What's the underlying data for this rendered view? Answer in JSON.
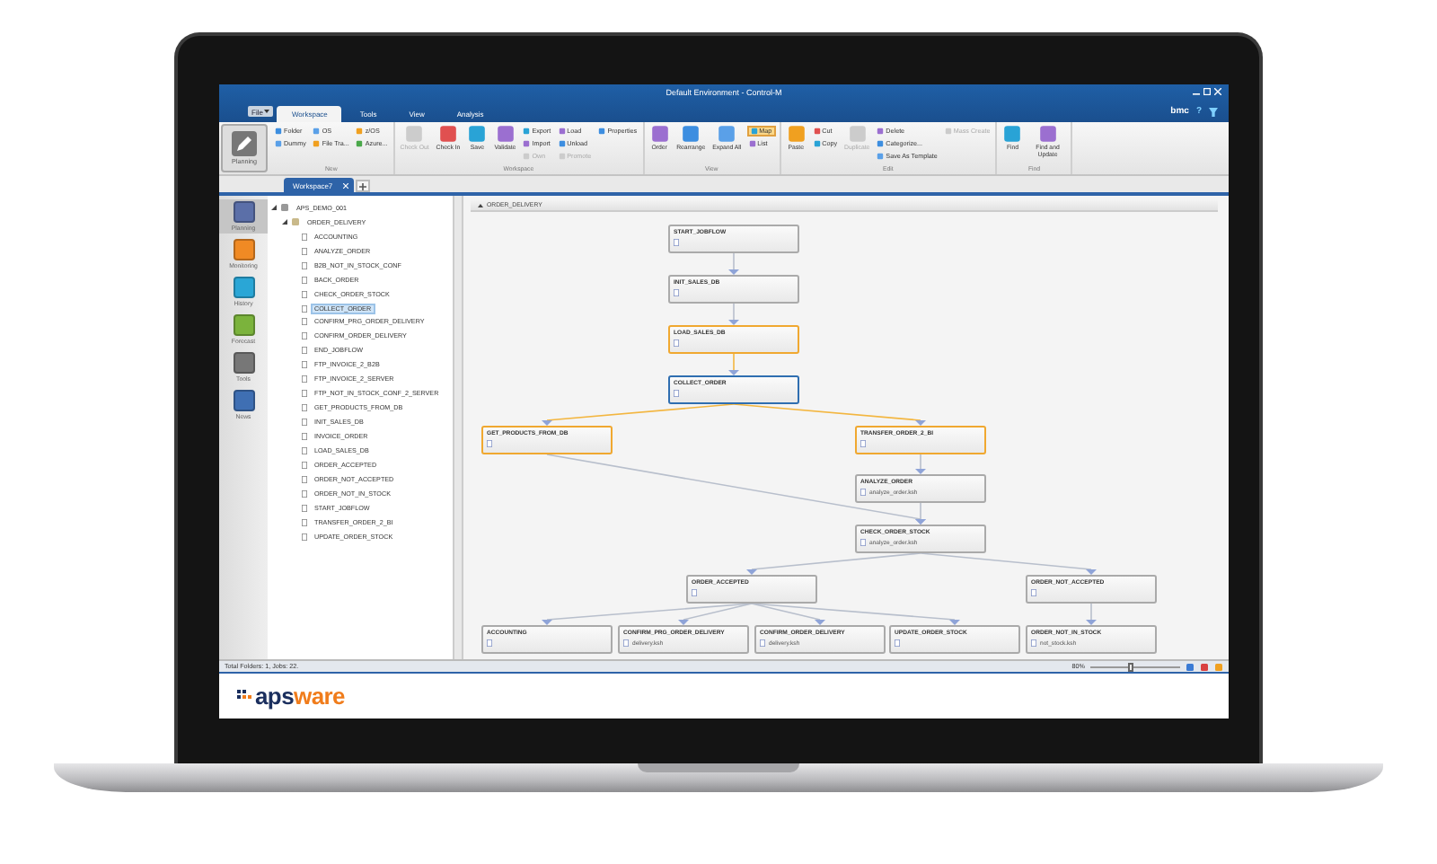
{
  "window": {
    "title": "Default Environment - Control-M"
  },
  "menu": {
    "file": "File",
    "tabs": [
      {
        "label": "Workspace",
        "selected": true
      },
      {
        "label": "Tools",
        "selected": false
      },
      {
        "label": "View",
        "selected": false
      },
      {
        "label": "Analysis",
        "selected": false
      }
    ],
    "brand": "bmc",
    "help": "?"
  },
  "ribbon": {
    "planning": {
      "label": "Planning"
    },
    "groups": [
      {
        "label": "New",
        "columns": [
          {
            "kind": "stack",
            "items": [
              {
                "label": "Folder",
                "disabled": false,
                "selected": false
              },
              {
                "label": "Dummy",
                "disabled": false,
                "selected": false
              }
            ]
          },
          {
            "kind": "stack",
            "items": [
              {
                "label": "OS",
                "disabled": false,
                "selected": false
              },
              {
                "label": "File Tra...",
                "disabled": false,
                "selected": false
              }
            ]
          },
          {
            "kind": "stack",
            "items": [
              {
                "label": "z/OS",
                "disabled": false,
                "selected": false
              },
              {
                "label": "Azure...",
                "disabled": false,
                "selected": false
              }
            ]
          }
        ]
      },
      {
        "label": "Workspace",
        "columns": [
          {
            "kind": "large",
            "label": "Check Out",
            "disabled": true
          },
          {
            "kind": "large",
            "label": "Check In",
            "disabled": false
          },
          {
            "kind": "large",
            "label": "Save",
            "disabled": false
          },
          {
            "kind": "large",
            "label": "Validate",
            "disabled": false
          },
          {
            "kind": "stack",
            "items": [
              {
                "label": "Export",
                "disabled": false,
                "selected": false
              },
              {
                "label": "Import",
                "disabled": false,
                "selected": false
              },
              {
                "label": "Own",
                "disabled": true,
                "selected": false
              }
            ]
          },
          {
            "kind": "stack",
            "items": [
              {
                "label": "Load",
                "disabled": false,
                "selected": false
              },
              {
                "label": "Unload",
                "disabled": false,
                "selected": false
              },
              {
                "label": "Promote",
                "disabled": true,
                "selected": false
              }
            ]
          },
          {
            "kind": "stack",
            "items": [
              {
                "label": "Properties",
                "disabled": false,
                "selected": false
              }
            ]
          }
        ]
      },
      {
        "label": "View",
        "columns": [
          {
            "kind": "large",
            "label": "Order",
            "disabled": false
          },
          {
            "kind": "large",
            "label": "Rearrange",
            "disabled": false
          },
          {
            "kind": "large",
            "label": "Expand All",
            "disabled": false
          },
          {
            "kind": "stack",
            "items": [
              {
                "label": "Map",
                "disabled": false,
                "selected": true
              },
              {
                "label": "List",
                "disabled": false,
                "selected": false
              }
            ]
          }
        ]
      },
      {
        "label": "Edit",
        "columns": [
          {
            "kind": "large",
            "label": "Paste",
            "disabled": false
          },
          {
            "kind": "stack",
            "items": [
              {
                "label": "Cut",
                "disabled": false,
                "selected": false
              },
              {
                "label": "Copy",
                "disabled": false,
                "selected": false
              }
            ]
          },
          {
            "kind": "large",
            "label": "Duplicate",
            "disabled": true
          },
          {
            "kind": "stack",
            "items": [
              {
                "label": "Delete",
                "disabled": false,
                "selected": false
              },
              {
                "label": "Categorize...",
                "disabled": false,
                "selected": false
              },
              {
                "label": "Save As Template",
                "disabled": false,
                "selected": false
              }
            ]
          },
          {
            "kind": "stack",
            "items": [
              {
                "label": "Mass Create",
                "disabled": true,
                "selected": false
              }
            ]
          }
        ]
      },
      {
        "label": "Find",
        "columns": [
          {
            "kind": "large",
            "label": "Find",
            "disabled": false
          },
          {
            "kind": "large",
            "label": "Find and Update",
            "disabled": false
          }
        ]
      }
    ]
  },
  "doc_tabs": [
    {
      "label": "Workspace7",
      "selected": true
    }
  ],
  "nav": [
    {
      "label": "Planning",
      "selected": true
    },
    {
      "label": "Monitoring",
      "selected": false
    },
    {
      "label": "History",
      "selected": false
    },
    {
      "label": "Forecast",
      "selected": false
    },
    {
      "label": "Tools",
      "selected": false
    },
    {
      "label": "News",
      "selected": false
    }
  ],
  "tree": {
    "label": "APS_DEMO_001",
    "expanded": true,
    "children": [
      {
        "label": "ORDER_DELIVERY",
        "expanded": true,
        "children": [
          {
            "label": "ACCOUNTING",
            "selected": false
          },
          {
            "label": "ANALYZE_ORDER",
            "selected": false
          },
          {
            "label": "B2B_NOT_IN_STOCK_CONF",
            "selected": false
          },
          {
            "label": "BACK_ORDER",
            "selected": false
          },
          {
            "label": "CHECK_ORDER_STOCK",
            "selected": false
          },
          {
            "label": "COLLECT_ORDER",
            "selected": true
          },
          {
            "label": "CONFIRM_PRG_ORDER_DELIVERY",
            "selected": false
          },
          {
            "label": "CONFIRM_ORDER_DELIVERY",
            "selected": false
          },
          {
            "label": "END_JOBFLOW",
            "selected": false
          },
          {
            "label": "FTP_INVOICE_2_B2B",
            "selected": false
          },
          {
            "label": "FTP_INVOICE_2_SERVER",
            "selected": false
          },
          {
            "label": "FTP_NOT_IN_STOCK_CONF_2_SERVER",
            "selected": false
          },
          {
            "label": "GET_PRODUCTS_FROM_DB",
            "selected": false
          },
          {
            "label": "INIT_SALES_DB",
            "selected": false
          },
          {
            "label": "INVOICE_ORDER",
            "selected": false
          },
          {
            "label": "LOAD_SALES_DB",
            "selected": false
          },
          {
            "label": "ORDER_ACCEPTED",
            "selected": false
          },
          {
            "label": "ORDER_NOT_ACCEPTED",
            "selected": false
          },
          {
            "label": "ORDER_NOT_IN_STOCK",
            "selected": false
          },
          {
            "label": "START_JOBFLOW",
            "selected": false
          },
          {
            "label": "TRANSFER_ORDER_2_BI",
            "selected": false
          },
          {
            "label": "UPDATE_ORDER_STOCK",
            "selected": false
          }
        ]
      }
    ]
  },
  "canvas": {
    "folder": "ORDER_DELIVERY",
    "nodes": [
      {
        "name": "START_JOBFLOW",
        "highlighted": false,
        "selected": false
      },
      {
        "name": "INIT_SALES_DB",
        "highlighted": false,
        "selected": false
      },
      {
        "name": "LOAD_SALES_DB",
        "highlighted": true,
        "selected": false
      },
      {
        "name": "COLLECT_ORDER",
        "highlighted": false,
        "selected": true
      },
      {
        "name": "GET_PRODUCTS_FROM_DB",
        "highlighted": true,
        "selected": false
      },
      {
        "name": "TRANSFER_ORDER_2_BI",
        "highlighted": true,
        "selected": false
      },
      {
        "name": "ANALYZE_ORDER",
        "script": "analyze_order.ksh",
        "highlighted": false,
        "selected": false
      },
      {
        "name": "CHECK_ORDER_STOCK",
        "script": "analyze_order.ksh",
        "highlighted": false,
        "selected": false
      },
      {
        "name": "ORDER_ACCEPTED",
        "highlighted": false,
        "selected": false
      },
      {
        "name": "ORDER_NOT_ACCEPTED",
        "highlighted": false,
        "selected": false
      },
      {
        "name": "ACCOUNTING",
        "highlighted": false,
        "selected": false
      },
      {
        "name": "CONFIRM_PRG_ORDER_DELIVERY",
        "script": "delivery.ksh",
        "highlighted": false,
        "selected": false
      },
      {
        "name": "CONFIRM_ORDER_DELIVERY",
        "script": "delivery.ksh",
        "highlighted": false,
        "selected": false
      },
      {
        "name": "UPDATE_ORDER_STOCK",
        "highlighted": false,
        "selected": false
      },
      {
        "name": "ORDER_NOT_IN_STOCK",
        "script": "not_stock.ksh",
        "highlighted": false,
        "selected": false
      }
    ]
  },
  "status_bar": {
    "text": "Total Folders: 1, Jobs: 22.",
    "zoom": "80%",
    "zoom_slider": {
      "level": 0.45
    }
  },
  "logo": {
    "dark": "aps",
    "accent": "ware"
  }
}
